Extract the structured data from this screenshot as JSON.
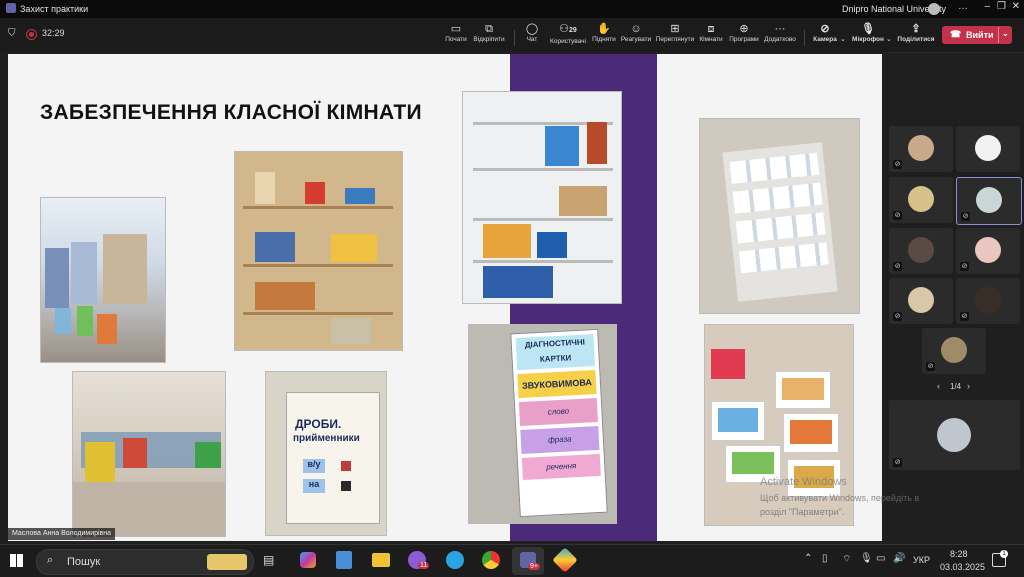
{
  "window": {
    "title": "Захист практики",
    "org": "Dnipro National University"
  },
  "meeting": {
    "timer": "32:29"
  },
  "toolbar": {
    "buttons": [
      {
        "label": "Почати"
      },
      {
        "label": "Відкріпити"
      },
      {
        "label": "Чат"
      },
      {
        "label": "Користувачі",
        "count": "29"
      },
      {
        "label": "Підняти"
      },
      {
        "label": "Реагувати"
      },
      {
        "label": "Переглянути"
      },
      {
        "label": "Кімнати"
      },
      {
        "label": "Програми"
      },
      {
        "label": "Додатково"
      },
      {
        "label": "Камера"
      },
      {
        "label": "Мікрофон"
      },
      {
        "label": "Поділитися"
      }
    ],
    "leave_label": "Вийти"
  },
  "slide": {
    "title": "ЗАБЕЗПЕЧЕННЯ КЛАСНОЇ КІМНАТИ"
  },
  "cards": {
    "fractions": {
      "title": "ДРОБИ.",
      "subtitle": "прийменники",
      "w1": "в/у",
      "w2": "на"
    },
    "sound": {
      "lines": [
        "ДІАГНОСТИЧНІ",
        "КАРТКИ",
        "ЗВУКОВИМОВА",
        "слово",
        "фраза",
        "речення"
      ]
    }
  },
  "presenter": {
    "name": "Маслова Анна Володимирівна"
  },
  "watermark": {
    "line1": "Activate Windows",
    "line2": "Щоб активувати Windows, перейдіть в",
    "line3": "розділ \"Параметри\"."
  },
  "pager": {
    "text": "1/4"
  },
  "taskbar": {
    "search_placeholder": "Пошук",
    "lang": "УКР",
    "time": "8:28",
    "date": "03.03.2025",
    "badge1": "11",
    "badge2": "9+"
  },
  "colors": {
    "accent": "#6264a7",
    "leave": "#c4314b",
    "slide_purple": "#4b2a7a"
  }
}
